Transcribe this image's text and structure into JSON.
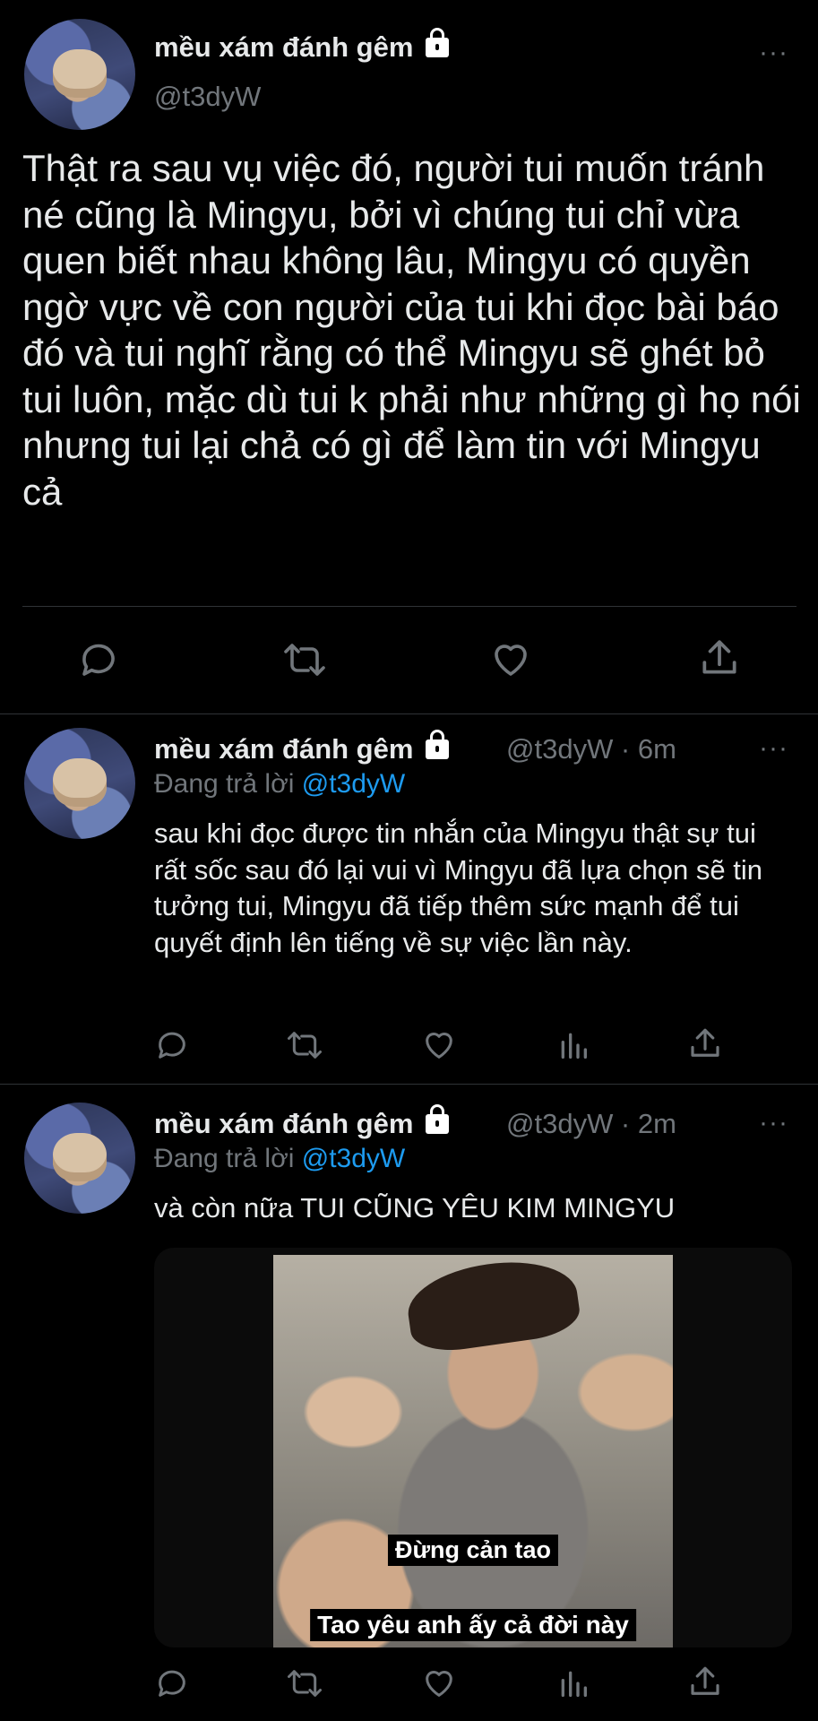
{
  "tweet1": {
    "name": "mều xám đánh gêm",
    "handle": "@t3dyW",
    "text": "Thật ra sau vụ việc đó, người tui muốn tránh né cũng là Mingyu, bởi vì chúng tui chỉ vừa quen biết nhau không lâu, Mingyu có quyền ngờ vực về con người của tui khi đọc bài báo đó và tui nghĩ rằng có thể Mingyu sẽ ghét bỏ tui luôn, mặc dù tui k phải như những gì họ nói nhưng tui lại chả có gì để làm tin với Mingyu cả",
    "more": "···"
  },
  "tweet2": {
    "name": "mều xám đánh gêm",
    "handle_time": "@t3dyW · 6m",
    "reply_prefix": "Đang trả lời",
    "reply_to": "@t3dyW",
    "text": "sau khi đọc được tin nhắn của Mingyu thật sự tui rất sốc sau đó lại vui vì Mingyu đã lựa chọn sẽ tin tưởng tui, Mingyu đã tiếp thêm sức mạnh để tui quyết định lên tiếng về sự việc lần này.",
    "more": "···"
  },
  "tweet3": {
    "name": "mều xám đánh gêm",
    "handle_time": "@t3dyW · 2m",
    "reply_prefix": "Đang trả lời",
    "reply_to": "@t3dyW",
    "text": "và còn nữa TUI CŨNG YÊU KIM MINGYU",
    "more": "···",
    "media_caption_1": "Đừng cản tao",
    "media_caption_2": "Tao yêu anh ấy cả đời này"
  },
  "icons": {
    "reply": "comment-icon",
    "retweet": "retweet-icon",
    "like": "heart-icon",
    "share": "share-icon",
    "analytics": "analytics-icon"
  },
  "colors": {
    "background": "#000000",
    "text": "#e7e9ea",
    "muted": "#71767b",
    "accent": "#1d9bf0"
  }
}
